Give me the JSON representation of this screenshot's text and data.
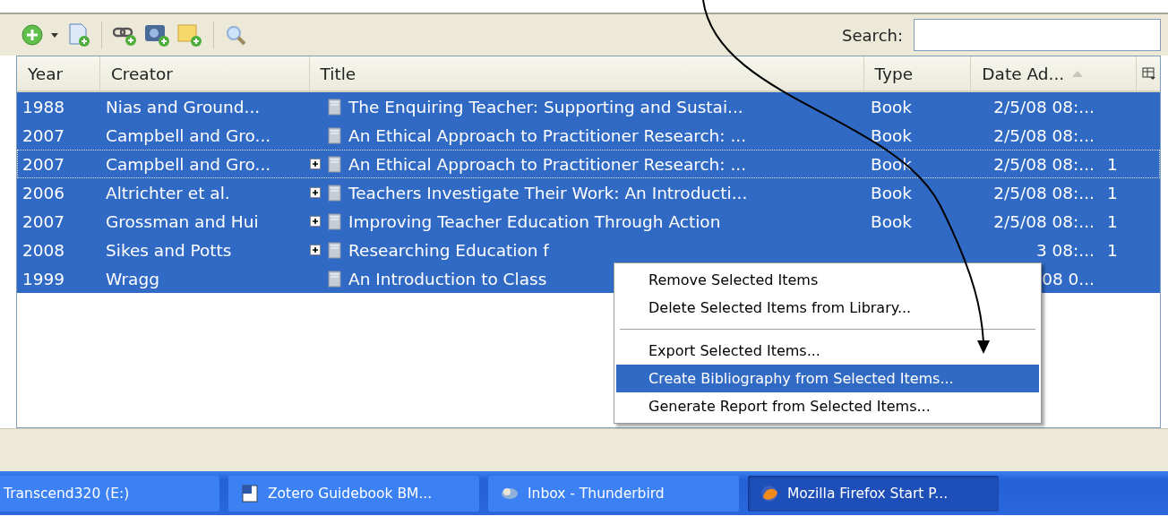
{
  "toolbar": {
    "search": {
      "label": "Search:"
    }
  },
  "table": {
    "columns": [
      {
        "label": "Year",
        "sorted": false
      },
      {
        "label": "Creator",
        "sorted": false
      },
      {
        "label": "Title",
        "sorted": false
      },
      {
        "label": "Type",
        "sorted": false
      },
      {
        "label": "Date Ad...",
        "sorted": true
      }
    ],
    "rows": [
      {
        "year": "1988",
        "creator": "Nias and Ground...",
        "expandable": false,
        "title": "The Enquiring Teacher: Supporting and Sustai...",
        "type": "Book",
        "date": "2/5/08 08:...",
        "selected": true,
        "focused": false
      },
      {
        "year": "2007",
        "creator": "Campbell and Gro...",
        "expandable": false,
        "title": "An Ethical Approach to Practitioner Research: ...",
        "type": "Book",
        "date": "2/5/08 08:...",
        "selected": true,
        "focused": false
      },
      {
        "year": "2007",
        "creator": "Campbell and Gro...",
        "expandable": true,
        "title": "An Ethical Approach to Practitioner Research: ...",
        "type": "Book",
        "date": "2/5/08 08:...",
        "count": "1",
        "selected": true,
        "focused": true
      },
      {
        "year": "2006",
        "creator": "Altrichter et al.",
        "expandable": true,
        "title": "Teachers Investigate Their Work: An Introducti...",
        "type": "Book",
        "date": "2/5/08 08:...",
        "count": "1",
        "selected": true,
        "focused": false
      },
      {
        "year": "2007",
        "creator": "Grossman and Hui",
        "expandable": true,
        "title": "Improving Teacher Education Through Action",
        "type": "Book",
        "date": "2/5/08 08:...",
        "count": "1",
        "selected": true,
        "focused": false
      },
      {
        "year": "2008",
        "creator": "Sikes and Potts",
        "expandable": true,
        "title": "Researching Education f",
        "date": "3 08:...",
        "count": "1",
        "selected": true,
        "focused": false
      },
      {
        "year": "1999",
        "creator": "Wragg",
        "expandable": false,
        "title": "An Introduction to Class",
        "date": "08 0...",
        "selected": true,
        "focused": false
      }
    ]
  },
  "context_menu": {
    "items": [
      {
        "kind": "item",
        "label": "Remove Selected Items",
        "selected": false
      },
      {
        "kind": "item",
        "label": "Delete Selected Items from Library...",
        "selected": false
      },
      {
        "kind": "separator"
      },
      {
        "kind": "item",
        "label": "Export Selected Items...",
        "selected": false
      },
      {
        "kind": "item",
        "label": "Create Bibliography from Selected Items...",
        "selected": true
      },
      {
        "kind": "item",
        "label": "Generate Report from Selected Items...",
        "selected": false
      }
    ]
  },
  "taskbar": {
    "items": [
      {
        "label": "Transcend320 (E:)",
        "selected": false
      },
      {
        "label": "Zotero Guidebook BM...",
        "selected": false
      },
      {
        "label": "Inbox - Thunderbird",
        "selected": false
      },
      {
        "label": "Mozilla Firefox Start P...",
        "selected": true
      }
    ]
  }
}
